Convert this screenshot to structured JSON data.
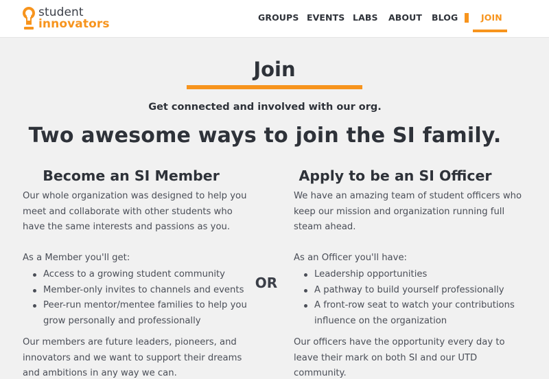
{
  "brand": {
    "line1": "student",
    "line2": "innovators",
    "accent_color": "#f7941d",
    "icon": "lightbulb-icon"
  },
  "nav": {
    "items": [
      {
        "label": "GROUPS"
      },
      {
        "label": "EVENTS"
      },
      {
        "label": "LABS"
      },
      {
        "label": "ABOUT"
      },
      {
        "label": "BLOG"
      },
      {
        "label": "JOIN",
        "active": true
      }
    ]
  },
  "page": {
    "title": "Join",
    "subtitle": "Get connected and involved with our org.",
    "headline": "Two awesome ways to join the SI family.",
    "or_label": "OR"
  },
  "member": {
    "heading": "Become an SI Member",
    "intro": "Our whole organization was designed to help you meet and collaborate with other students who have the same interests and passions as you.",
    "lead": "As a Member you'll get:",
    "benefits": [
      "Access to a growing student community",
      "Member-only invites to channels and events",
      "Peer-run mentor/mentee families to help you grow personally and professionally"
    ],
    "closing": "Our members are future leaders, pioneers, and innovators and we want to support their dreams and ambitions in any way we can."
  },
  "officer": {
    "heading": "Apply to be an SI Officer",
    "intro": "We have an amazing team of student officers who keep our mission and organization running full steam ahead.",
    "lead": "As an Officer you'll have:",
    "benefits": [
      "Leadership opportunities",
      "A pathway to build yourself professionally",
      "A front-row seat to watch your contributions influence on the organization"
    ],
    "closing": "Our officers have the opportunity every day to leave their mark on both SI and our UTD community."
  }
}
